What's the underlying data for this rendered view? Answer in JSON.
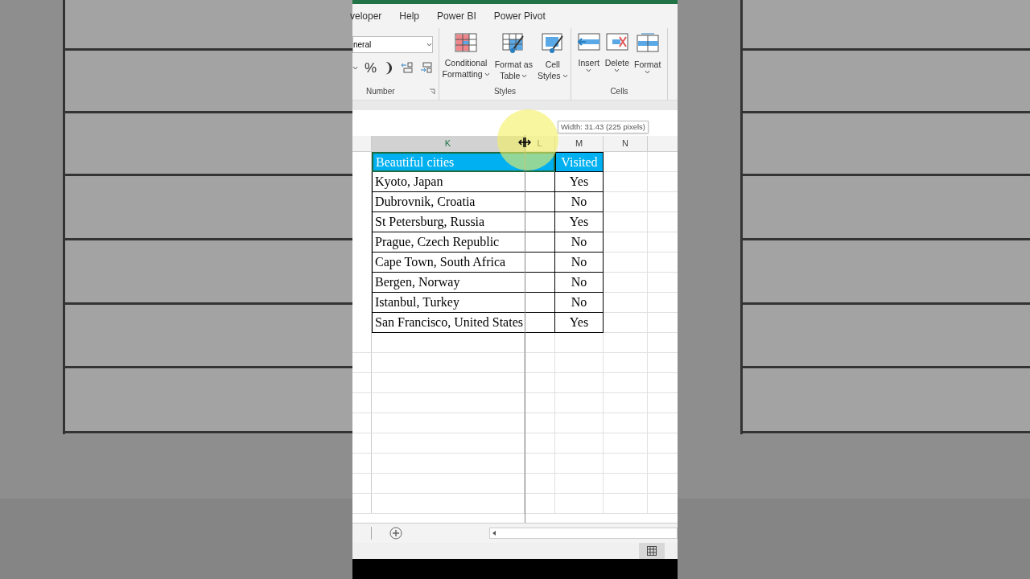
{
  "ribbon_tabs": [
    {
      "label": "veloper",
      "selected": false
    },
    {
      "label": "Help",
      "selected": false
    },
    {
      "label": "Power BI",
      "selected": false
    },
    {
      "label": "Power Pivot",
      "selected": false
    }
  ],
  "number_group": {
    "format": "neral",
    "symbols": [
      "%",
      "❩"
    ],
    "label": "Number"
  },
  "styles_group": {
    "label": "Styles",
    "buttons": [
      {
        "kind": "conditional",
        "line1": "Conditional",
        "line2": "Formatting"
      },
      {
        "kind": "table",
        "line1": "Format as",
        "line2": "Table"
      },
      {
        "kind": "cellstyles",
        "line1": "Cell",
        "line2": "Styles"
      }
    ]
  },
  "cells_group": {
    "label": "Cells",
    "buttons": [
      {
        "kind": "insert",
        "label": "Insert"
      },
      {
        "kind": "delete",
        "label": "Delete"
      },
      {
        "kind": "format",
        "label": "Format"
      }
    ]
  },
  "tooltip": "Width: 31.43 (225 pixels)",
  "columns": [
    {
      "label": "K",
      "selected": true
    },
    {
      "label": "L",
      "selected": false
    },
    {
      "label": "M",
      "selected": false
    },
    {
      "label": "N",
      "selected": false
    }
  ],
  "table": {
    "headers": [
      "Beautiful cities",
      "Visited"
    ],
    "rows": [
      [
        "Kyoto, Japan",
        "Yes"
      ],
      [
        "Dubrovnik, Croatia",
        "No"
      ],
      [
        "St Petersburg, Russia",
        "Yes"
      ],
      [
        "Prague, Czech Republic",
        "No"
      ],
      [
        "Cape Town, South Africa",
        "No"
      ],
      [
        "Bergen, Norway",
        "No"
      ],
      [
        "Istanbul, Turkey",
        "No"
      ],
      [
        "San Francisco, United States",
        "Yes"
      ]
    ]
  }
}
